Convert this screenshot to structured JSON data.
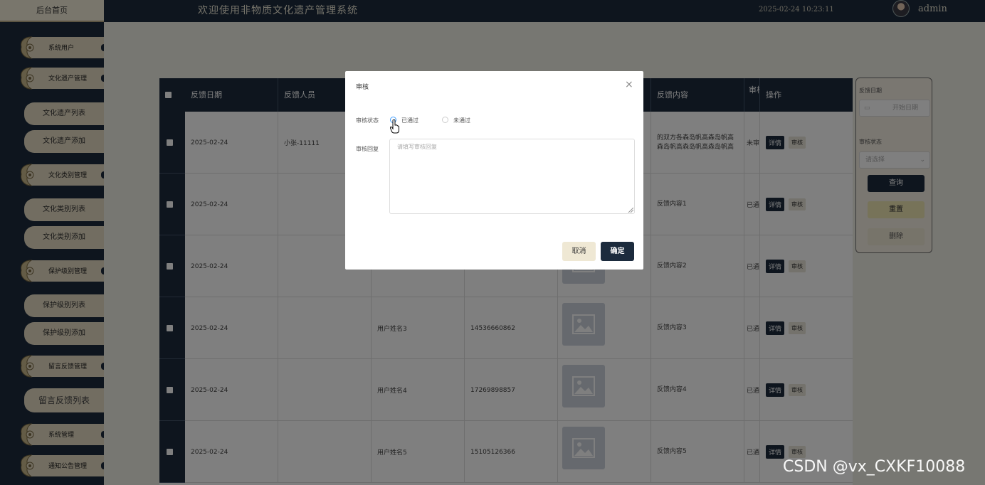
{
  "header": {
    "home_tab": "后台首页",
    "title": "欢迎使用非物质文化遗产管理系统",
    "datetime": "2025-02-24 10:23:11",
    "username": "admin"
  },
  "sidebar": {
    "groups": [
      {
        "label": "系统用户"
      },
      {
        "label": "文化遗产管理"
      },
      {
        "label": "文化类别管理"
      },
      {
        "label": "保护级别管理"
      },
      {
        "label": "留言反馈管理"
      },
      {
        "label": "系统管理"
      },
      {
        "label": "通知公告管理"
      }
    ],
    "items": [
      {
        "label": "文化遗产列表"
      },
      {
        "label": "文化遗产添加"
      },
      {
        "label": "文化类别列表"
      },
      {
        "label": "文化类别添加"
      },
      {
        "label": "保护级别列表"
      },
      {
        "label": "保护级别添加"
      },
      {
        "label": "留言反馈列表"
      }
    ]
  },
  "table": {
    "headers": [
      "反馈日期",
      "反馈人员",
      "",
      "",
      "",
      "反馈内容",
      "审核状态",
      "操作"
    ],
    "header_status_short": "审核状态",
    "detail_label": "详情",
    "audit_label": "审核",
    "rows": [
      {
        "date": "2025-02-24",
        "user": "小张-11111",
        "name": "",
        "phone": "",
        "content": "的双方各森岛帆高森岛帆高森岛帆高森岛帆高森岛帆高",
        "status": "未审"
      },
      {
        "date": "2025-02-24",
        "user": "",
        "name": "",
        "phone": "",
        "content": "反馈内容1",
        "status": "已通"
      },
      {
        "date": "2025-02-24",
        "user": "",
        "name": "",
        "phone": "",
        "content": "反馈内容2",
        "status": "已通"
      },
      {
        "date": "2025-02-24",
        "user": "",
        "name": "用户姓名3",
        "phone": "14536660862",
        "content": "反馈内容3",
        "status": "已通"
      },
      {
        "date": "2025-02-24",
        "user": "",
        "name": "用户姓名4",
        "phone": "17269898857",
        "content": "反馈内容4",
        "status": "已通"
      },
      {
        "date": "2025-02-24",
        "user": "",
        "name": "用户姓名5",
        "phone": "15105126366",
        "content": "反馈内容5",
        "status": "已通"
      }
    ]
  },
  "filter": {
    "date_label": "反馈日期",
    "date_placeholder": "开始日期",
    "status_label": "审核状态",
    "status_placeholder": "请选择",
    "query_label": "查询",
    "reset_label": "重置",
    "delete_label": "删除"
  },
  "dialog": {
    "title": "审核",
    "close": "×",
    "status_label": "审核状态",
    "option_pass": "已通过",
    "option_fail": "未通过",
    "selected": "已通过",
    "reply_label": "审核回复",
    "reply_placeholder": "请填写审核回复",
    "cancel_label": "取消",
    "ok_label": "确定"
  },
  "watermark": "CSDN @vx_CXKF10088"
}
